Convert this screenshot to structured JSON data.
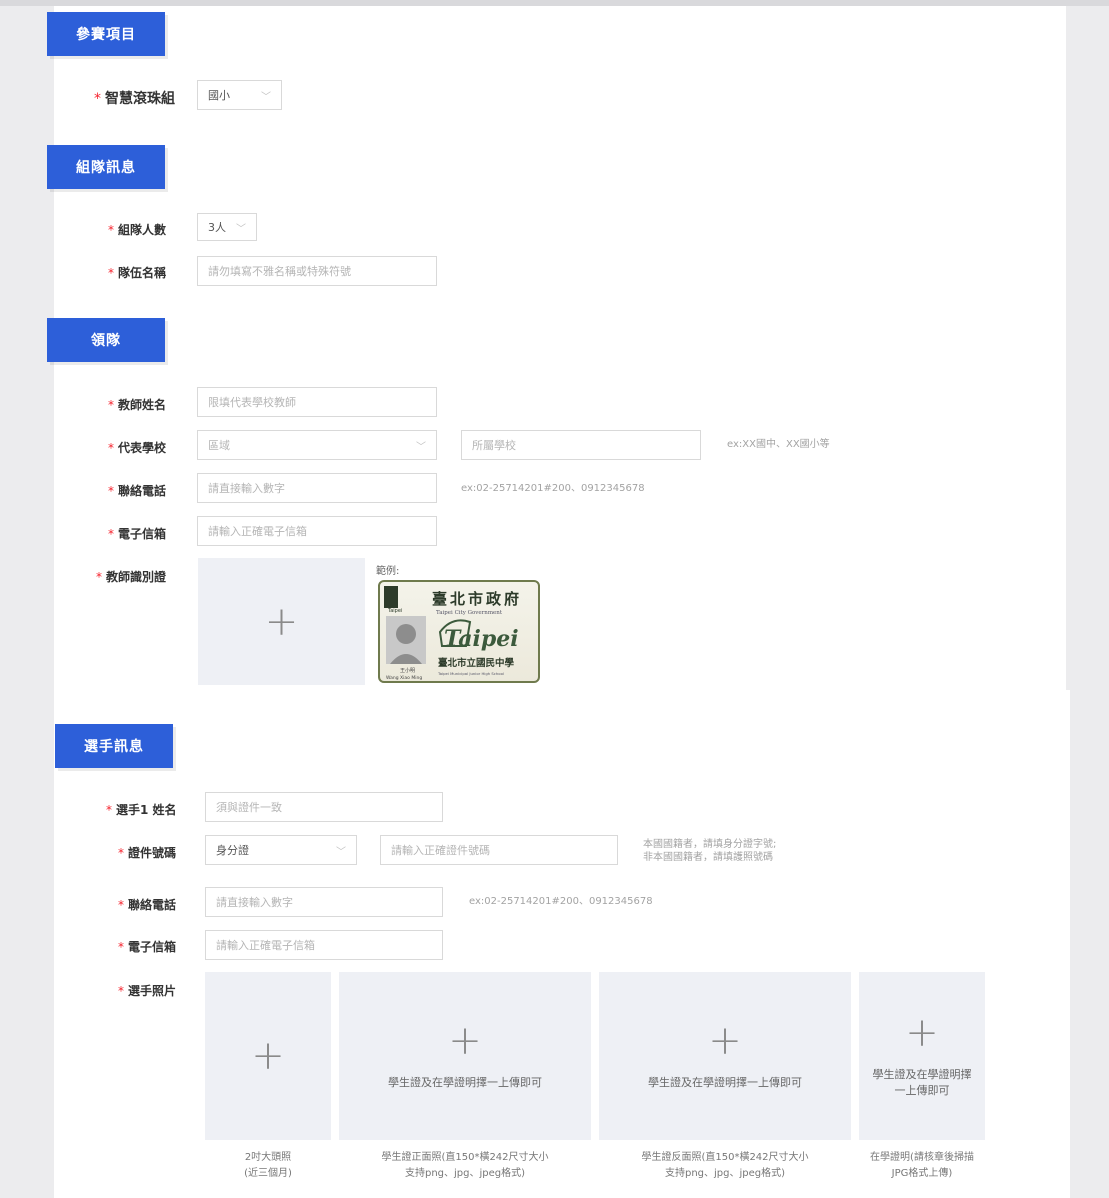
{
  "sections": {
    "event": "參賽項目",
    "team_info": "組隊訊息",
    "leader": "領隊",
    "player_info": "選手訊息"
  },
  "event": {
    "label": "智慧滾珠組",
    "select_value": "國小"
  },
  "team": {
    "size_label": "組隊人數",
    "size_value": "3人",
    "name_label": "隊伍名稱",
    "name_placeholder": "請勿填寫不雅名稱或特殊符號"
  },
  "leader": {
    "teacher_label": "教師姓名",
    "teacher_placeholder": "限填代表學校教師",
    "school_label": "代表學校",
    "district_placeholder": "區域",
    "school_placeholder": "所屬學校",
    "school_hint": "ex:XX國中、XX國小等",
    "phone_label": "聯絡電話",
    "phone_placeholder": "請直接輸入數字",
    "phone_hint": "ex:02-25714201#200、0912345678",
    "email_label": "電子信箱",
    "email_placeholder": "請輸入正確電子信箱",
    "id_label": "教師識別證",
    "example_label": "範例:",
    "card": {
      "gov_cn": "臺北市政府",
      "gov_en": "Taipei City Government",
      "logo_text": "Taipei",
      "school_cn": "臺北市立國民中學",
      "school_en": "Taipei Municipal Junior High School",
      "name_cn": "王小明",
      "name_en": "Wang Xiao Ming"
    }
  },
  "player": {
    "name_label": "選手1 姓名",
    "name_placeholder": "須與證件一致",
    "id_label": "證件號碼",
    "id_type_value": "身分證",
    "id_placeholder": "請輸入正確證件號碼",
    "id_hint_line1": "本國國籍者，請填身分證字號;",
    "id_hint_line2": "非本國國籍者，請填護照號碼",
    "phone_label": "聯絡電話",
    "phone_placeholder": "請直接輸入數字",
    "phone_hint": "ex:02-25714201#200、0912345678",
    "email_label": "電子信箱",
    "email_placeholder": "請輸入正確電子信箱",
    "photo_label": "選手照片",
    "uploads": [
      {
        "text": "",
        "caption1": "2吋大頭照",
        "caption2": "(近三個月)"
      },
      {
        "text": "學生證及在學證明擇一上傳即可",
        "caption1": "學生證正面照(直150*橫242尺寸大小",
        "caption2": "支持png、jpg、jpeg格式)"
      },
      {
        "text": "學生證及在學證明擇一上傳即可",
        "caption1": "學生證反面照(直150*橫242尺寸大小",
        "caption2": "支持png、jpg、jpeg格式)"
      },
      {
        "text1": "學生證及在學證明擇",
        "text2": "一上傳即可",
        "caption1": "在學證明(請核章後掃描",
        "caption2": "JPG格式上傳)"
      }
    ]
  },
  "plus_glyph": "+",
  "required_mark": "*",
  "chevron": "﹀"
}
